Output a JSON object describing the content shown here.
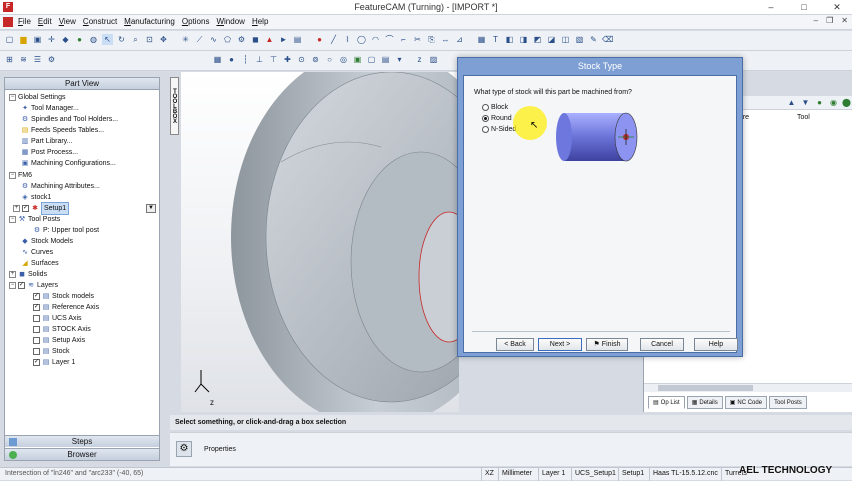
{
  "window": {
    "title": "FeatureCAM (Turning) - [IMPORT *]",
    "app_icon_letter": "F",
    "controls": [
      "–",
      "□",
      "✕"
    ]
  },
  "menu": [
    "File",
    "Edit",
    "View",
    "Construct",
    "Manufacturing",
    "Options",
    "Window",
    "Help"
  ],
  "part_view": {
    "header": "Part View",
    "items": [
      {
        "label": "Global Settings"
      },
      {
        "label": "Tool Manager..."
      },
      {
        "label": "Spindles and Tool Holders..."
      },
      {
        "label": "Feeds  Speeds Tables..."
      },
      {
        "label": "Part Library..."
      },
      {
        "label": "Post Process..."
      },
      {
        "label": "Machining Configurations..."
      },
      {
        "label": "FM6"
      },
      {
        "label": "Machining Attributes..."
      },
      {
        "label": "stock1"
      },
      {
        "label": "Setup1"
      },
      {
        "label": "Tool Posts"
      },
      {
        "label": "P: Upper tool post"
      },
      {
        "label": "Stock Models"
      },
      {
        "label": "Curves"
      },
      {
        "label": "Surfaces"
      },
      {
        "label": "Solids"
      },
      {
        "label": "Layers"
      },
      {
        "label": "Stock models"
      },
      {
        "label": "Reference Axis"
      },
      {
        "label": "UCS Axis"
      },
      {
        "label": "STOCK Axis"
      },
      {
        "label": "Setup Axis"
      },
      {
        "label": "Stock"
      },
      {
        "label": "Layer 1"
      }
    ],
    "bottom_tabs": [
      "Steps",
      "Browser"
    ]
  },
  "toolbox_label": "TOOLBOX",
  "viewport": {
    "axis_labels": {
      "y": "y",
      "z": "z"
    }
  },
  "right_panel": {
    "columns": [
      "ture",
      "Tool"
    ],
    "tabs": [
      "Op List",
      "Details",
      "NC Code",
      "Tool Posts"
    ]
  },
  "dialog": {
    "title": "Stock Type",
    "question": "What type of stock will this part be machined from?",
    "options": [
      {
        "label": "Block",
        "selected": false
      },
      {
        "label": "Round",
        "selected": true
      },
      {
        "label": "N-Sided",
        "selected": false
      }
    ],
    "buttons": {
      "back": "< Back",
      "next": "Next >",
      "finish": "Finish",
      "cancel": "Cancel",
      "help": "Help"
    }
  },
  "status_message": "Select something, or click-and-drag a box selection",
  "properties_label": "Properties",
  "status_bar": {
    "left": "Intersection of \"ln246\" and \"arc233\" (-40, 65)",
    "cells": [
      "XZ",
      "Millimeter",
      "Layer 1",
      "UCS_Setup1",
      "Setup1",
      "Haas TL-15.5.12.cnc",
      "Turrets"
    ]
  },
  "watermark": "AEL TECHNOLOGY",
  "colors": {
    "dialog_frame": "#7d9fd4",
    "part_gray": "#b9c1c8",
    "stock_cylinder": "#6b73d8",
    "highlight_yellow": "#fff000"
  }
}
